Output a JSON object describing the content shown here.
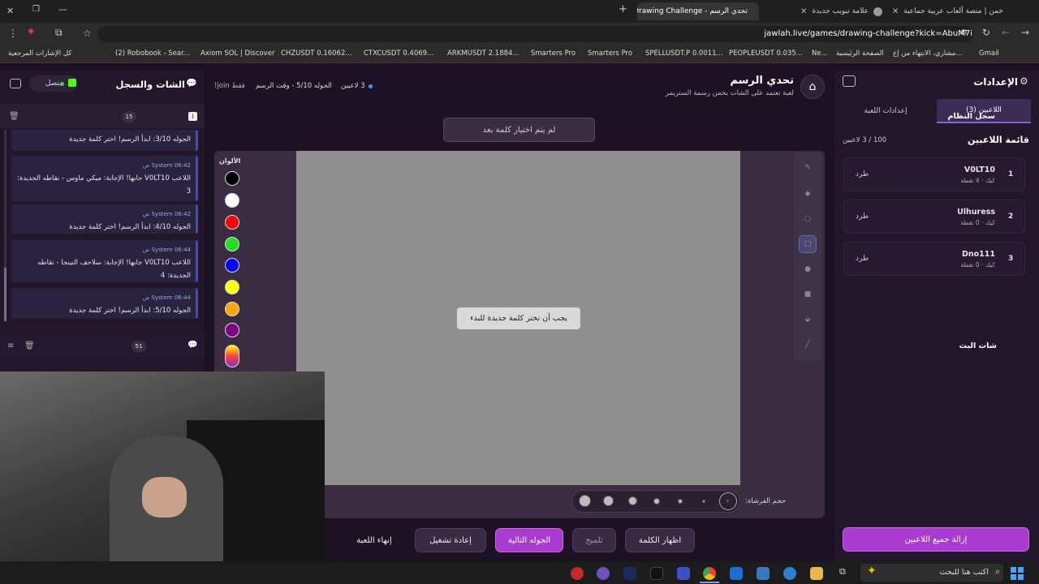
{
  "browser": {
    "tabs": [
      {
        "title": "خمن | منصة ألعاب عربية جماعية"
      },
      {
        "title": "علامة تبويب جديدة"
      },
      {
        "title": "تحدي الرسم - Drawing Challenge"
      }
    ],
    "url": "jawlah.live/games/drawing-challenge?kick=AbuM7i",
    "bookmarks": [
      "Gmail",
      "مشاري، الانتهاء من إع...",
      "الصفحة الرئيسية",
      "Ne...",
      "PEOPLEUSDT 0.035...",
      "SPELLUSDT.P 0.0011...",
      "Smarters Pro",
      "Smarters Pro",
      "ARKMUSDT 2.1884...",
      "CTXCUSDT 0.4069...",
      "CHZUSDT 0.16062...",
      "Axiom SOL | Discover",
      "(2) Robobook - Sear...",
      "كل الإشارات المرجعية"
    ]
  },
  "right": {
    "title": "الإعدادات",
    "tabs": {
      "players": "اللاعبين (3)",
      "settings": "إعدادات اللعبة"
    },
    "list_title": "قائمة اللاعبين",
    "count": "100 / 3 لاعبين",
    "players": [
      {
        "rank": "1",
        "name": "V0LT10",
        "sub": "كيك · 4 نقطة",
        "kick": "طرد"
      },
      {
        "rank": "2",
        "name": "Ulhuress",
        "sub": "كيك · 0 نقطة",
        "kick": "طرد"
      },
      {
        "rank": "3",
        "name": "Dno111",
        "sub": "كيك · 0 نقطة",
        "kick": "طرد"
      }
    ],
    "remove_all": "إزالة جميع اللاعبين"
  },
  "left": {
    "title": "الشات والسجل",
    "status": "متصل",
    "log_title": "سجل النظام",
    "log_count": "15",
    "logs": [
      {
        "text": "الجوله 3/10: ابدأ الرسم! اختر كلمة جديدة",
        "meta": ""
      },
      {
        "text": "اللاعب V0LT10 جابها! الإجابة: ميكي ماوس - نقاطه الجديدة: 3",
        "meta": "System  06:42 ص"
      },
      {
        "text": "الجوله 4/10: ابدأ الرسم! اختر كلمة جديدة",
        "meta": "System  06:42 ص"
      },
      {
        "text": "اللاعب V0LT10 جابها! الإجابة: سلاحف النينجا - نقاطه الجديدة: 4",
        "meta": "System  06:44 ص"
      },
      {
        "text": "الجوله 5/10: ابدأ الرسم! اختر كلمة جديدة",
        "meta": "System  06:44 ص"
      }
    ],
    "chat_title": "شات البث",
    "chat_count": "51"
  },
  "game": {
    "title": "تحدي الرسم",
    "subtitle": "لعبة تعتمد على الشات يخمن رسمة الستريمر",
    "players_badge": "3 لاعبين",
    "round_info": "الجوله 5/10 - وقت الرسم",
    "join_note": "!join فقط",
    "word_placeholder": "لم يتم اختيار كلمة بعد",
    "canvas_msg": "يجب أن تختر كلمة جديدة للبدء",
    "colors_label": "الألوان",
    "colors": [
      "#000000",
      "#ffffff",
      "#ff0000",
      "#22dd22",
      "#0000ff",
      "#ffff00",
      "#ffa500",
      "#800080"
    ],
    "brush_label": "حجم الفرشاة:",
    "buttons": {
      "end": "إنهاء اللعبة",
      "restart": "إعادة تشغيل",
      "next": "الجوله التالية",
      "hint": "تلميح",
      "reveal": "اظهار الكلمة"
    }
  },
  "taskbar": {
    "search": "اكتب هنا للبحث"
  }
}
